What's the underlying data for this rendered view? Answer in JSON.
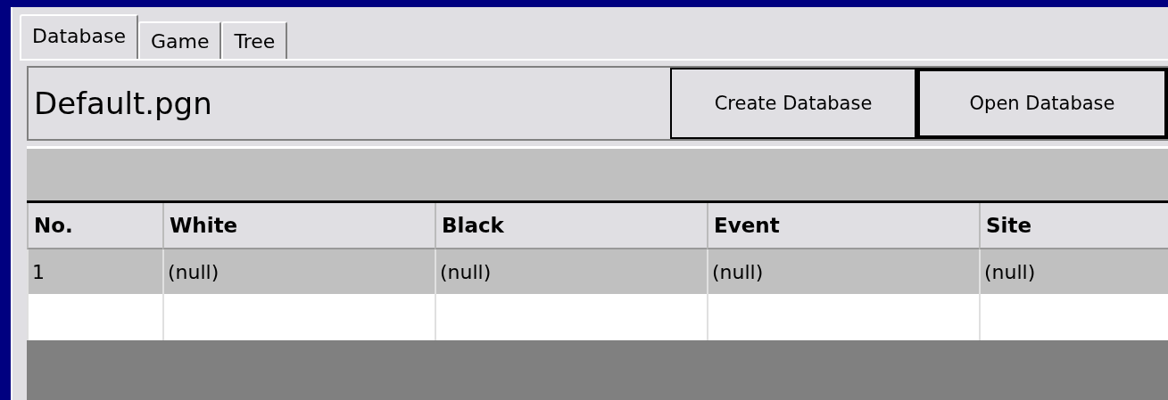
{
  "tabs": [
    {
      "label": "Database",
      "selected": true
    },
    {
      "label": "Game",
      "selected": false
    },
    {
      "label": "Tree",
      "selected": false
    }
  ],
  "database": {
    "title": "Default.pgn"
  },
  "buttons": [
    {
      "label": "Create Database",
      "default": false
    },
    {
      "label": "Open Database",
      "default": true
    }
  ],
  "table": {
    "columns": [
      "No.",
      "White",
      "Black",
      "Event",
      "Site"
    ],
    "rows": [
      {
        "cells": [
          "1",
          "(null)",
          "(null)",
          "(null)",
          "(null)"
        ],
        "selected": true
      }
    ]
  }
}
